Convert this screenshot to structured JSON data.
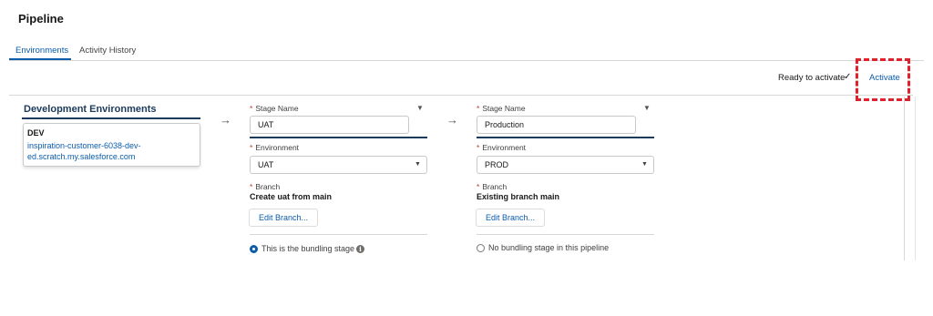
{
  "page": {
    "title": "Pipeline"
  },
  "tabs": [
    {
      "label": "Environments",
      "active": true
    },
    {
      "label": "Activity History",
      "active": false
    }
  ],
  "status": {
    "ready_text": "Ready to activate",
    "check_icon": "✓",
    "activate_label": "Activate"
  },
  "dev_env": {
    "heading": "Development Environments",
    "card_name": "DEV",
    "card_link": "inspiration-customer-6038-dev-ed.scratch.my.salesforce.com"
  },
  "arrow_icon": "→",
  "stages": [
    {
      "stage_name_label": "Stage Name",
      "stage_name_value": "UAT",
      "environment_label": "Environment",
      "environment_value": "UAT",
      "branch_label": "Branch",
      "branch_value": "Create uat from main",
      "edit_branch_label": "Edit Branch...",
      "bundling_text": "This is the bundling stage",
      "bundling_checked": true
    },
    {
      "stage_name_label": "Stage Name",
      "stage_name_value": "Production",
      "environment_label": "Environment",
      "environment_value": "PROD",
      "branch_label": "Branch",
      "branch_value": "Existing branch main",
      "edit_branch_label": "Edit Branch...",
      "bundling_text": "No bundling stage in this pipeline",
      "bundling_checked": false
    }
  ],
  "required_mark": "*",
  "info_icon": "i",
  "colors": {
    "accent": "#0b5cab",
    "highlight": "#e0202a",
    "heading": "#1b3a5c"
  }
}
